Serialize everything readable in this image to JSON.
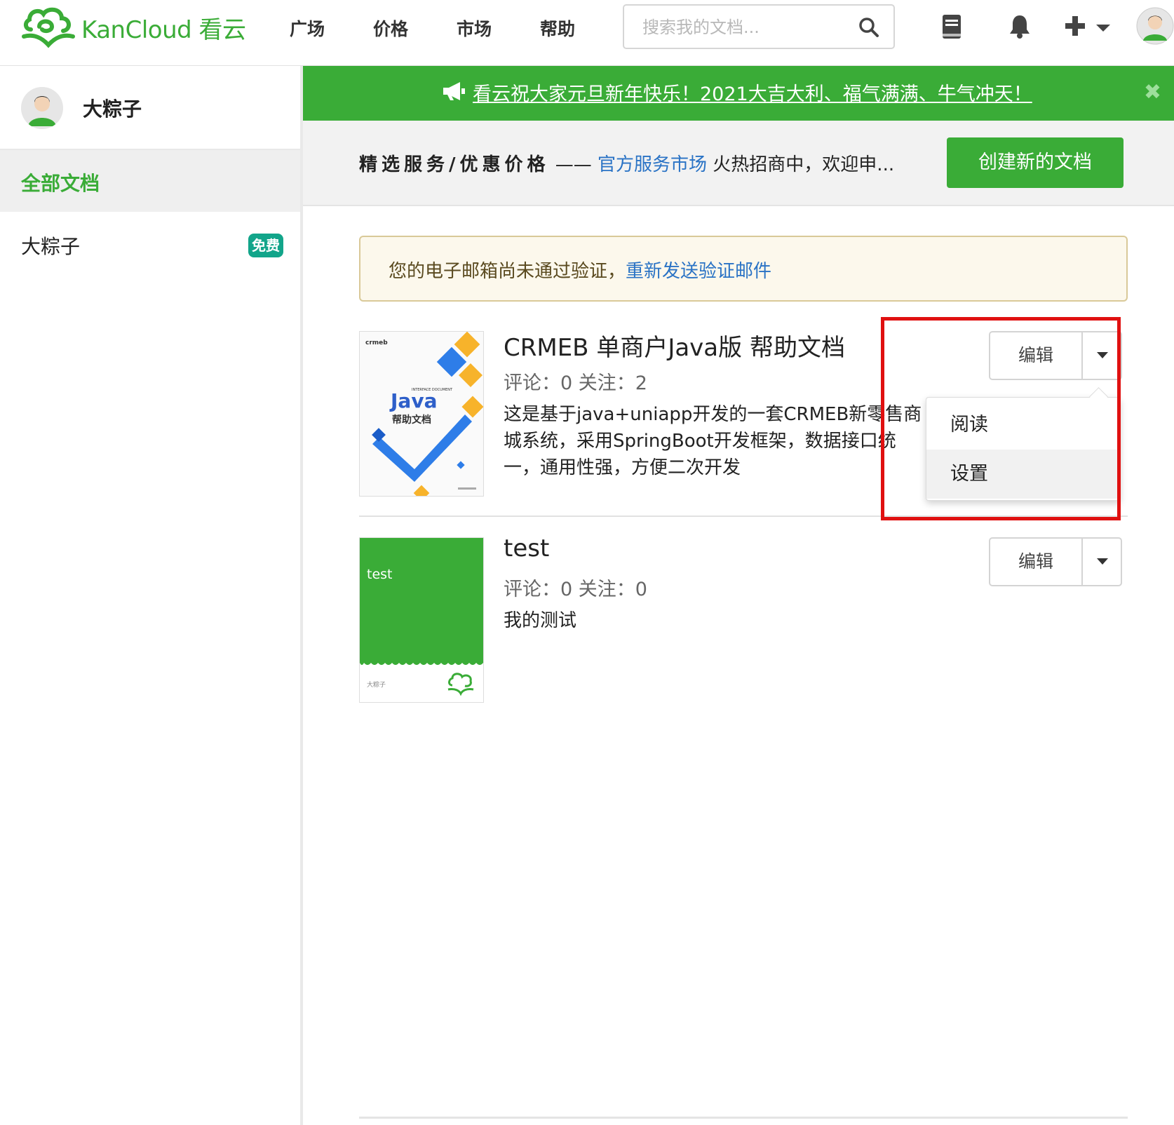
{
  "brand": {
    "logo_text": "KanCloud 看云",
    "accent": "#3aac37"
  },
  "nav": {
    "items": [
      "广场",
      "价格",
      "市场",
      "帮助"
    ],
    "search_placeholder": "搜索我的文档...",
    "icons": [
      "search-icon",
      "book-icon",
      "bell-icon",
      "plus-icon",
      "chevron-down-icon",
      "avatar"
    ]
  },
  "sidebar": {
    "username": "大粽子",
    "active_item": "全部文档",
    "items": [
      {
        "label": "大粽子",
        "badge": "免费"
      }
    ]
  },
  "announcement": {
    "text": "看云祝大家元旦新年快乐！2021大吉大利、福气满满、牛气冲天！",
    "close": "✖"
  },
  "promo": {
    "strong": "精选服务/优惠价格",
    "dash": " —— ",
    "link": "官方服务市场",
    "rest": " 火热招商中，欢迎申...",
    "create_button": "创建新的文档"
  },
  "alert": {
    "text": "您的电子邮箱尚未通过验证，",
    "link": "重新发送验证邮件"
  },
  "docs": [
    {
      "title": "CRMEB 单商户Java版 帮助文档",
      "meta": "评论：0 关注：2",
      "description": "这是基于java+uniapp开发的一套CRMEB新零售商城系统，采用SpringBoot开发框架，数据接口统一，通用性强，方便二次开发",
      "cover": {
        "brand": "crmeb",
        "title": "Java",
        "subtitle": "帮助文档",
        "small": "INTERFACE DOCUMENT"
      },
      "edit_label": "编辑"
    },
    {
      "title": "test",
      "meta": "评论：0 关注：0",
      "description": "我的测试",
      "cover": {
        "title": "test",
        "author": "大粽子"
      },
      "edit_label": "编辑"
    }
  ],
  "dropdown": {
    "items": [
      "阅读",
      "设置"
    ]
  }
}
